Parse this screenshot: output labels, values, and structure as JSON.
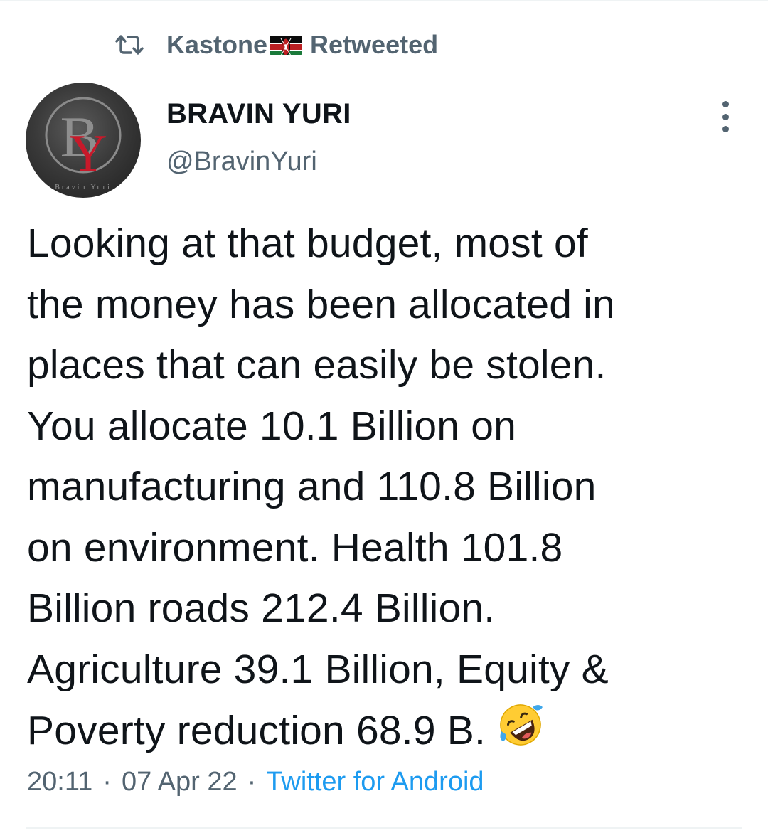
{
  "retweet": {
    "icon": "retweet-icon",
    "user": "Kastone",
    "flag": "kenya-flag",
    "label": "Retweeted"
  },
  "author": {
    "avatar_initials": "BY",
    "avatar_caption": "Bravin Yuri",
    "name": "BRAVIN YURI",
    "handle": "@BravinYuri"
  },
  "tweet": {
    "lines": [
      "Looking at that budget, most of",
      "the money has been allocated in",
      "places that can easily be stolen.",
      "You allocate 10.1 Billion on",
      "manufacturing and 110.8 Billion",
      "on environment. Health 101.8",
      "Billion roads 212.4 Billion.",
      "Agriculture 39.1 Billion, Equity &",
      "Poverty reduction 68.9 B."
    ],
    "emoji": "rolling-on-floor-laughing-emoji"
  },
  "meta": {
    "time": "20:11",
    "separator": "·",
    "date": "07 Apr 22",
    "source": "Twitter for Android"
  },
  "colors": {
    "text": "#0f1419",
    "secondary": "#536471",
    "link": "#1d9bf0",
    "divider": "#eff3f4"
  }
}
